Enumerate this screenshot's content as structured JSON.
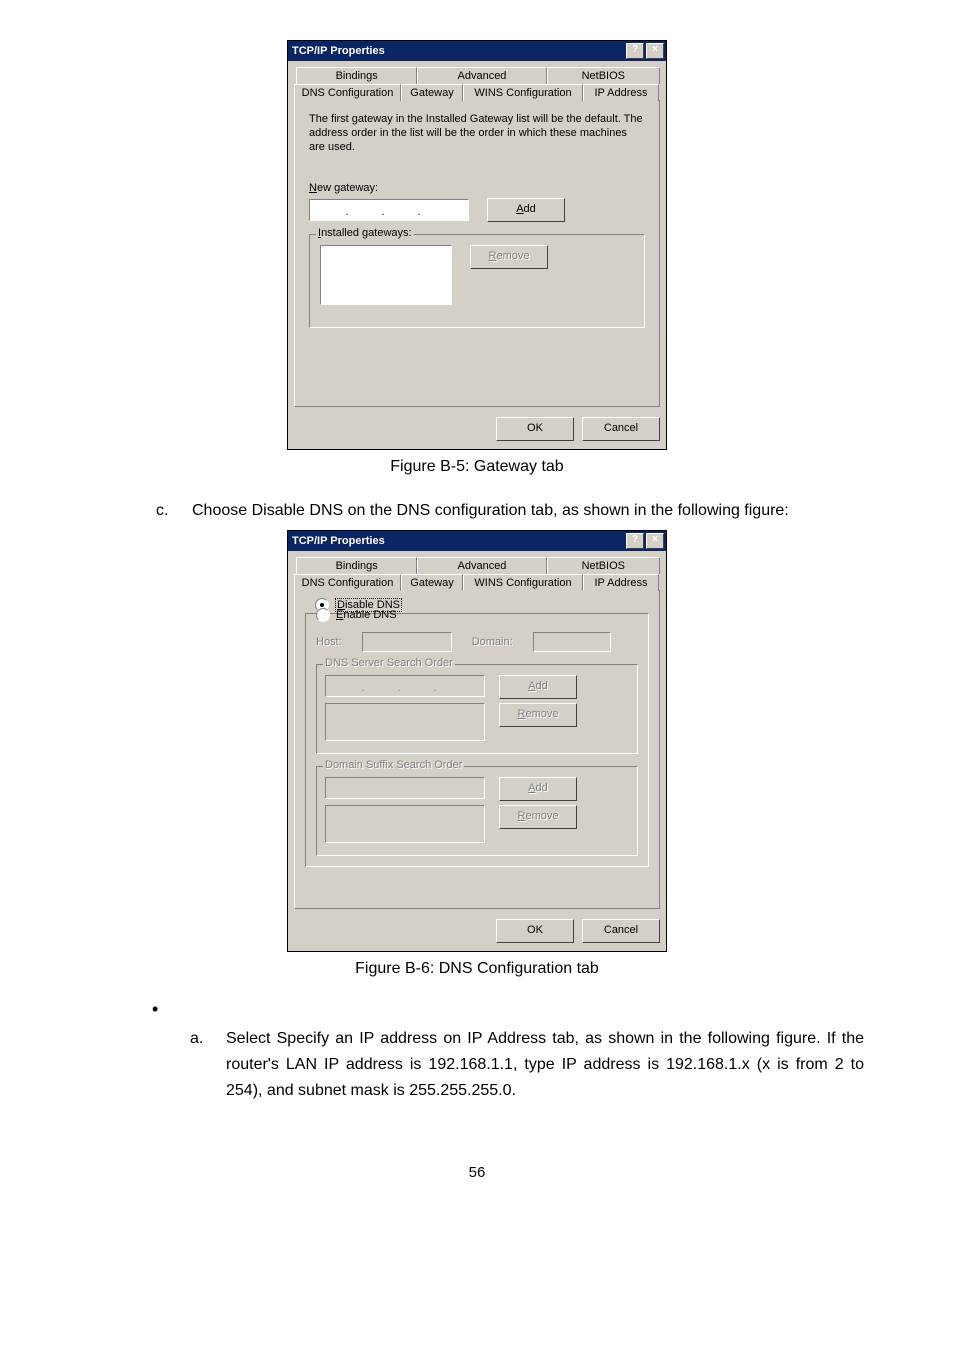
{
  "dialog1": {
    "title": "TCP/IP Properties",
    "help_glyph": "?",
    "close_glyph": "×",
    "tabs_row1": {
      "bindings": "Bindings",
      "advanced": "Advanced",
      "netbios": "NetBIOS"
    },
    "tabs_row2": {
      "dnsconfig": "DNS Configuration",
      "gateway": "Gateway",
      "winsconfig": "WINS Configuration",
      "ipaddress": "IP Address"
    },
    "gateway_instructions": "The first gateway in the Installed Gateway list will be the default. The address order in the list will be the order in which these machines are used.",
    "new_gateway_label": "New gateway:",
    "add_btn": "Add",
    "installed_label": "Installed gateways:",
    "remove_btn": "Remove",
    "ok_btn": "OK",
    "cancel_btn": "Cancel"
  },
  "caption1": "Figure B-5: Gateway tab",
  "step_c_marker": "c.",
  "step_c_text": "Choose Disable DNS on the DNS configuration tab, as shown in the following figure:",
  "dialog2": {
    "title": "TCP/IP Properties",
    "help_glyph": "?",
    "close_glyph": "×",
    "tabs_row1": {
      "bindings": "Bindings",
      "advanced": "Advanced",
      "netbios": "NetBIOS"
    },
    "tabs_row2": {
      "dnsconfig": "DNS Configuration",
      "gateway": "Gateway",
      "winsconfig": "WINS Configuration",
      "ipaddress": "IP Address"
    },
    "disable_dns": "Disable DNS",
    "enable_dns": "Enable DNS",
    "host_label": "Host:",
    "domain_label": "Domain:",
    "dns_search_label": "DNS Server Search Order",
    "add_btn": "Add",
    "remove_btn": "Remove",
    "domain_suffix_label": "Domain Suffix Search Order",
    "ok_btn": "OK",
    "cancel_btn": "Cancel"
  },
  "caption2": "Figure B-6: DNS Configuration tab",
  "bullet": "•",
  "step_a_marker": "a.",
  "step_a_text": "Select Specify an IP address on IP Address tab, as shown in the following figure. If the router's LAN IP address is 192.168.1.1, type IP address is 192.168.1.x (x is from 2 to 254), and subnet mask is 255.255.255.0.",
  "page_number": "56"
}
